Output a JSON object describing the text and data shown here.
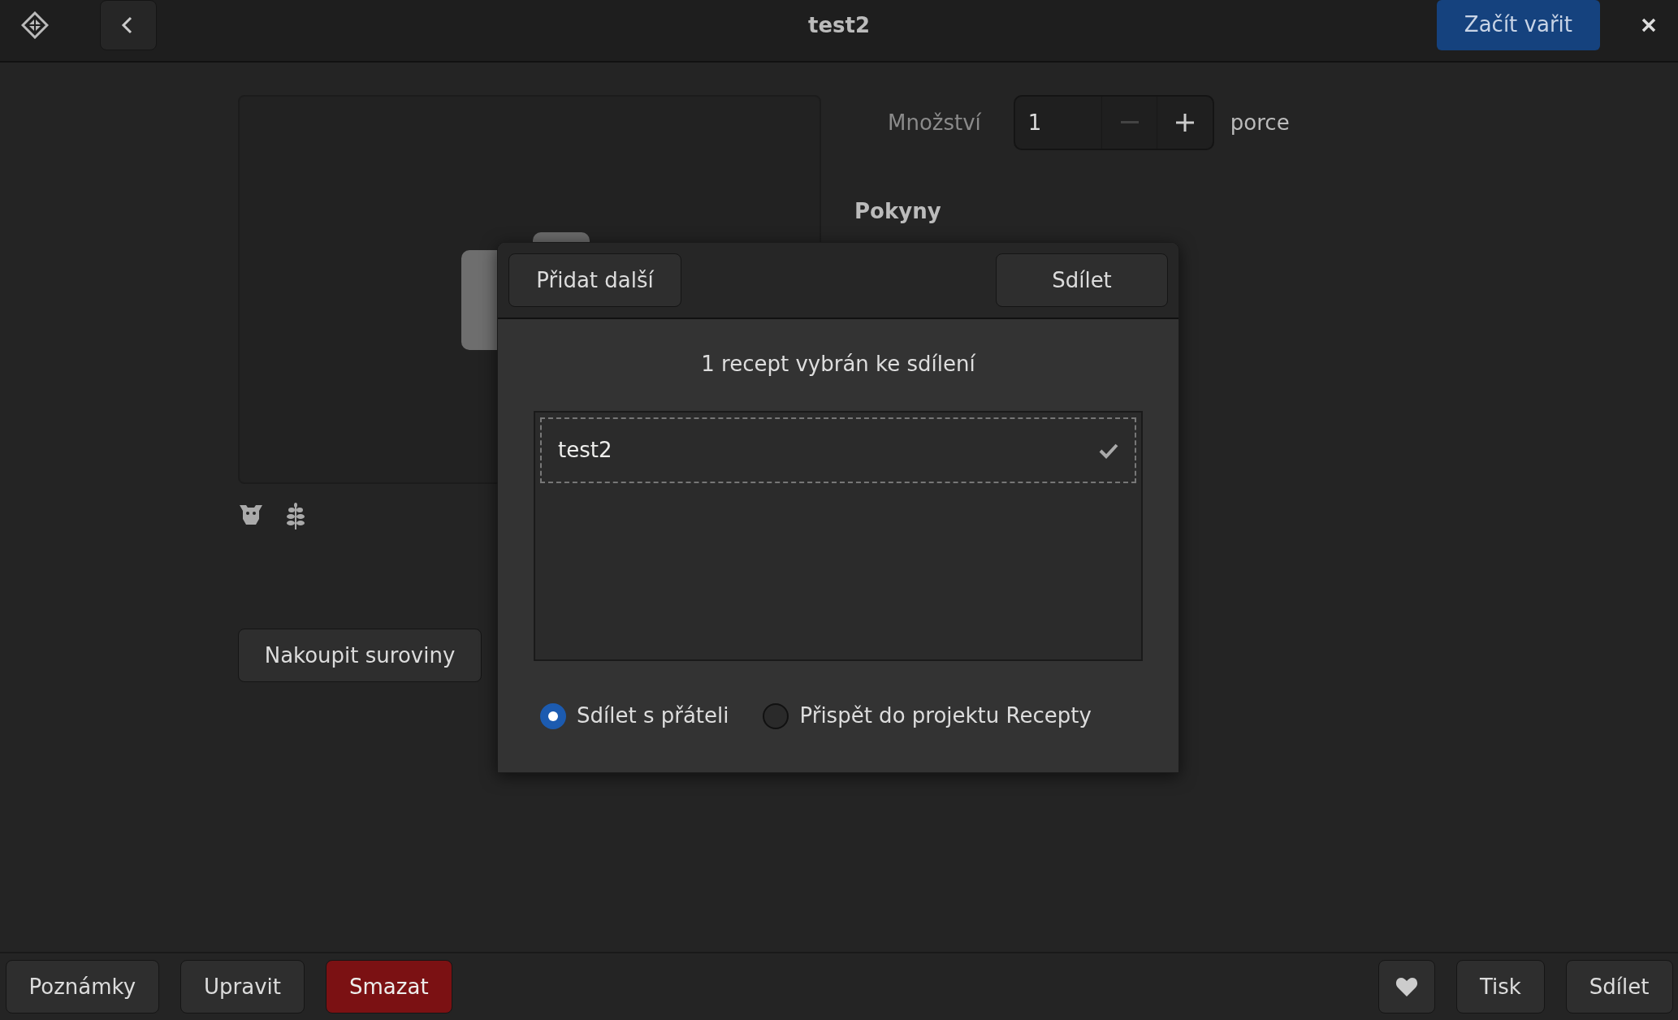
{
  "window": {
    "title": "test2",
    "primary_action": "Začít vařit"
  },
  "recipe": {
    "shop_button": "Nakoupit suroviny",
    "quantity": {
      "label": "Množství",
      "value": "1",
      "unit": "porce",
      "decrement_disabled": true
    },
    "instructions_heading": "Pokyny"
  },
  "share_dialog": {
    "add_button": "Přidat další",
    "share_button": "Sdílet",
    "message": "1 recept vybrán ke sdílení",
    "recipes": [
      {
        "name": "test2",
        "checked": true,
        "focused": true
      }
    ],
    "options": [
      {
        "label": "Sdílet s přáteli",
        "selected": true
      },
      {
        "label": "Přispět do projektu Recepty",
        "selected": false
      }
    ]
  },
  "bottom_bar": {
    "left": [
      {
        "label": "Poznámky",
        "kind": "normal"
      },
      {
        "label": "Upravit",
        "kind": "normal"
      },
      {
        "label": "Smazat",
        "kind": "destructive"
      }
    ],
    "right": [
      {
        "kind": "heart"
      },
      {
        "label": "Tisk",
        "kind": "normal"
      },
      {
        "label": "Sdílet",
        "kind": "normal"
      }
    ]
  }
}
